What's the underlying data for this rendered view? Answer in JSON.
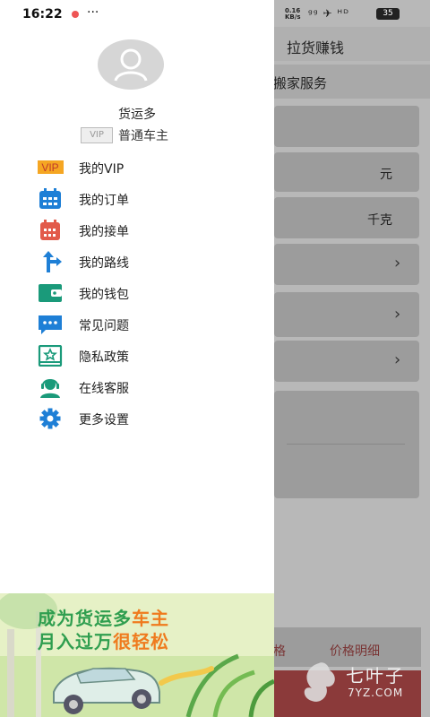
{
  "status_bar": {
    "time": "16:22",
    "more": "···",
    "net": "0.16\nKB/s",
    "icons": "ᵍᵍ ✈ ᴴᴰ",
    "battery": "35"
  },
  "background_app": {
    "title": "拉货赚钱",
    "subtitle": "搬家服务",
    "unit_yuan": "元",
    "unit_kg": "千克",
    "footer_left": "格",
    "footer_right": "价格明细"
  },
  "watermark": {
    "text": "七叶子",
    "domain": "7YZ.COM"
  },
  "drawer": {
    "username": "货运多",
    "vip_tag": "VIP",
    "vip_level": "普通车主",
    "menu": [
      {
        "label": "我的VIP",
        "icon": "vip-icon"
      },
      {
        "label": "我的订单",
        "icon": "calendar-blue-icon"
      },
      {
        "label": "我的接单",
        "icon": "calendar-red-icon"
      },
      {
        "label": "我的路线",
        "icon": "route-icon"
      },
      {
        "label": "我的钱包",
        "icon": "wallet-icon"
      },
      {
        "label": "常见问题",
        "icon": "chat-icon"
      },
      {
        "label": "隐私政策",
        "icon": "privacy-icon"
      },
      {
        "label": "在线客服",
        "icon": "customer-service-icon"
      },
      {
        "label": "更多设置",
        "icon": "gear-icon"
      }
    ],
    "promo": {
      "line1_a": "成为货运多",
      "line1_b": "车主",
      "line2_a": "月入过万",
      "line2_b": "很轻松"
    }
  },
  "colors": {
    "accent_green": "#2f9e4f",
    "accent_orange": "#ef7b1e",
    "icon_blue": "#1e7fd6",
    "icon_red": "#e25a4a",
    "icon_teal": "#1a9a7a"
  }
}
